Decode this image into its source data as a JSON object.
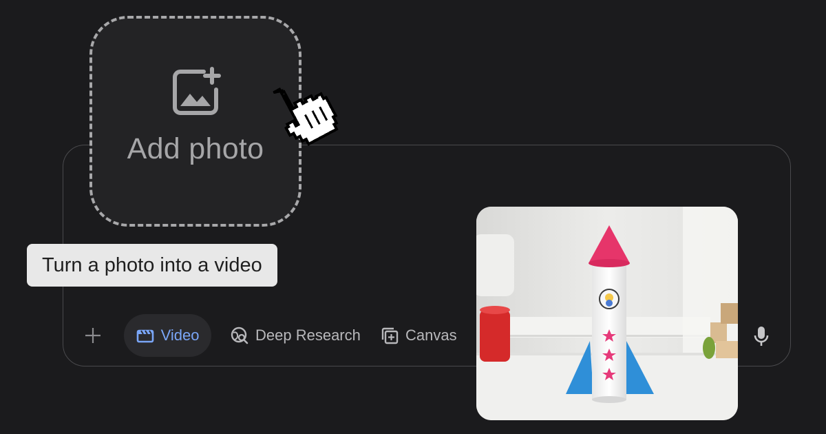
{
  "add_photo": {
    "label": "Add photo",
    "icon": "add-photo-icon"
  },
  "cursor": {
    "icon": "hand-pointer-icon"
  },
  "tooltip": {
    "text": "Turn a photo into a video"
  },
  "toolbar": {
    "plus_icon": "plus-icon",
    "video_label": "Video",
    "video_icon": "clapperboard-icon",
    "research_label": "Deep Research",
    "research_icon": "globe-search-icon",
    "canvas_label": "Canvas",
    "canvas_icon": "canvas-add-icon",
    "mic_icon": "microphone-icon"
  },
  "colors": {
    "background": "#1b1b1d",
    "accent": "#7aa6f7",
    "tooltip_bg": "#e8e8e8"
  },
  "photo": {
    "subject": "rocket-toy-photo"
  }
}
